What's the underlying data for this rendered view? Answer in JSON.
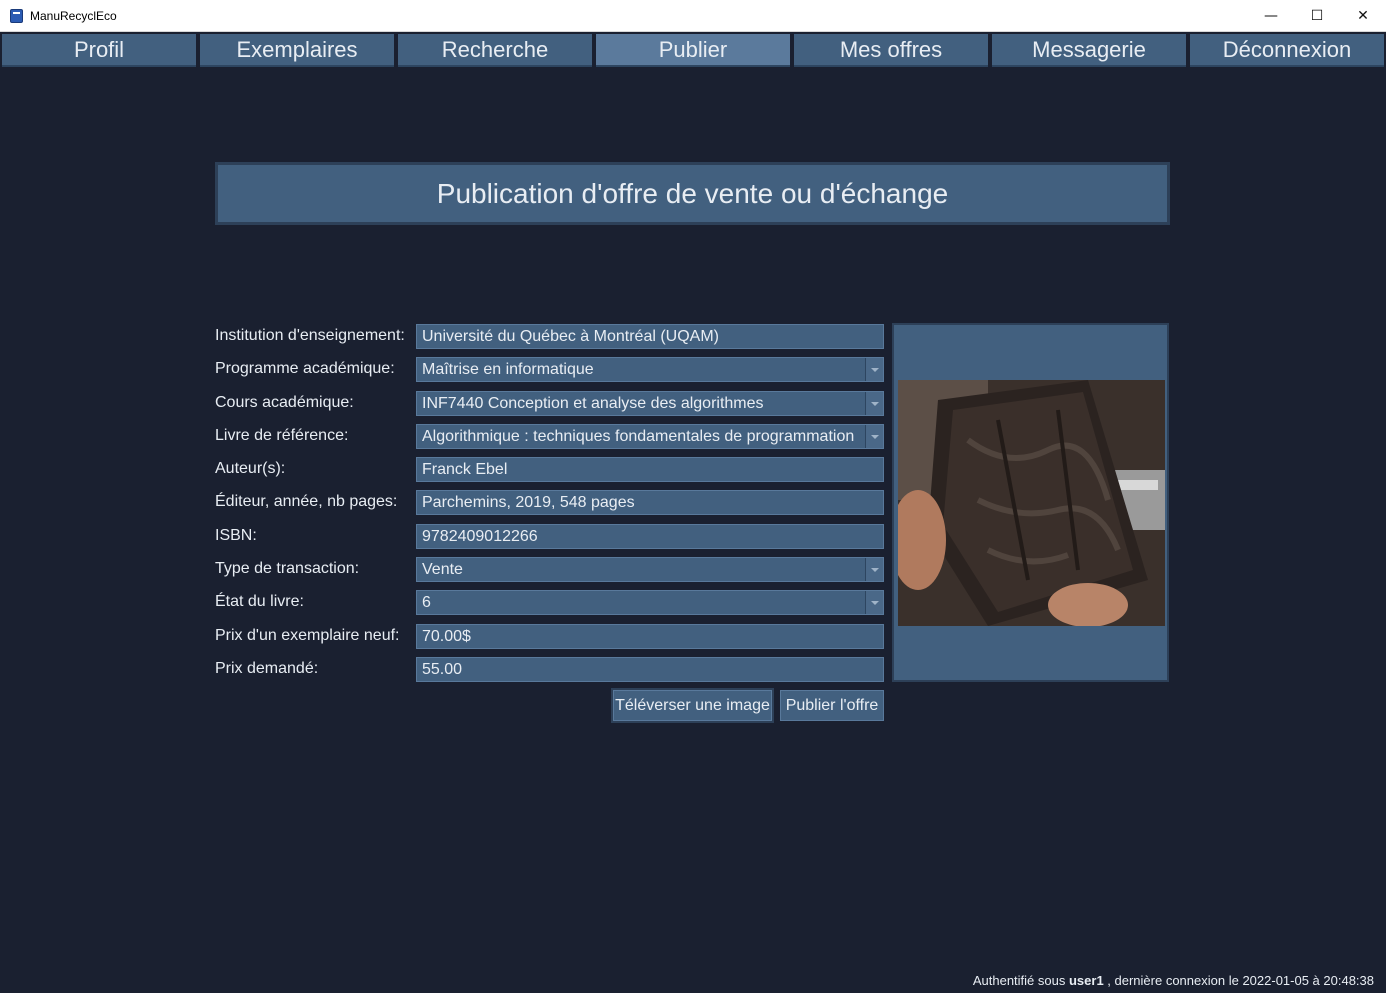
{
  "window": {
    "title": "ManuRecyclEco",
    "controls": {
      "minimize": "—",
      "maximize": "☐",
      "close": "✕"
    }
  },
  "menu": {
    "items": [
      {
        "label": "Profil"
      },
      {
        "label": "Exemplaires"
      },
      {
        "label": "Recherche"
      },
      {
        "label": "Publier",
        "active": true
      },
      {
        "label": "Mes offres"
      },
      {
        "label": "Messagerie"
      },
      {
        "label": "Déconnexion"
      }
    ]
  },
  "page": {
    "title": "Publication d'offre de vente ou d'échange"
  },
  "form": {
    "institution": {
      "label": "Institution d'enseignement:",
      "value": "Université du Québec à Montréal (UQAM)"
    },
    "programme": {
      "label": "Programme académique:",
      "value": "Maîtrise en informatique"
    },
    "cours": {
      "label": "Cours académique:",
      "value": "INF7440 Conception et analyse des algorithmes"
    },
    "livre": {
      "label": "Livre de référence:",
      "value": "Algorithmique : techniques fondamentales de programmation"
    },
    "auteurs": {
      "label": "Auteur(s):",
      "value": "Franck Ebel"
    },
    "editeur": {
      "label": "Éditeur, année, nb pages:",
      "value": "Parchemins, 2019, 548 pages"
    },
    "isbn": {
      "label": "ISBN:",
      "value": "9782409012266"
    },
    "transaction": {
      "label": "Type de transaction:",
      "value": "Vente"
    },
    "etat": {
      "label": "État du livre:",
      "value": "6"
    },
    "prix_neuf": {
      "label": "Prix d'un exemplaire neuf:",
      "value": "70.00$"
    },
    "prix_demande": {
      "label": "Prix demandé:",
      "value": "55.00"
    }
  },
  "buttons": {
    "upload": "Téléverser une image",
    "publish": "Publier l'offre"
  },
  "status": {
    "prefix": "Authentifié sous ",
    "user": "user1",
    "suffix": " , dernière connexion le 2022-01-05 à 20:48:38"
  }
}
